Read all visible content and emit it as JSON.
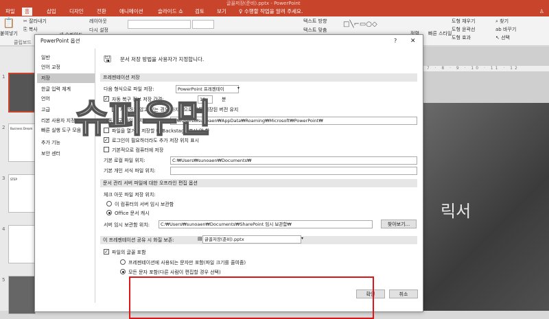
{
  "window": {
    "title": "글꼴저장(준비).pptx - PowerPoint"
  },
  "ribbon": {
    "tabs": [
      "파일",
      "홈",
      "삽입",
      "디자인",
      "전환",
      "애니메이션",
      "슬라이드 쇼",
      "검토",
      "보기"
    ],
    "active_tab": "홈",
    "tell_me": "수행할 작업을 알려 주세요.",
    "clipboard": {
      "paste": "붙여넣기",
      "cut": "잘라내기",
      "copy": "복사",
      "group_label": "클립보드"
    },
    "slides": {
      "new_slide": "새 슬라이드",
      "layout": "레이아웃",
      "reset": "다시 설정"
    },
    "paragraph": {
      "text_direction": "텍스트 방향",
      "align_text": "텍스트 맞춤"
    },
    "drawing": {
      "arrange": "정렬",
      "quick_styles": "빠른 스타일",
      "shape_fill": "도형 채우기",
      "shape_outline": "도형 윤곽선",
      "shape_effects": "도형 효과"
    },
    "editing": {
      "find": "찾기",
      "replace": "바꾸기",
      "select": "선택",
      "group_label": "편집"
    },
    "accent_color": "#c8442b"
  },
  "slide_pane": {
    "numbers": [
      "1",
      "2",
      "3",
      "4",
      "5"
    ],
    "thumb_text": [
      "Business Dream",
      "STEP"
    ]
  },
  "slide": {
    "big_text": "릭서",
    "ruler": "· 7 · 8 · 9 · 10 · 11 · 12"
  },
  "watermark": "슈퍼우먼",
  "dialog": {
    "title": "PowerPoint 옵션",
    "help": "?",
    "close": "✕",
    "nav": [
      "일반",
      "언어 교정",
      "저장",
      "한글 입력 체계",
      "언어",
      "고급",
      "리본 사용자 지정",
      "빠른 실행 도구 모음",
      "추가 기능",
      "보안 센터"
    ],
    "nav_active": "저장",
    "header": "문서 저장 방법을 사용자가 지정합니다.",
    "sec_save": "프레젠테이션 저장",
    "format_label": "다음 형식으로 파일 저장:",
    "format_value": "PowerPoint 프레젠테이",
    "autorecover_label": "자동 복구 정보 저장 간격:",
    "autorecover_minutes": "10",
    "minutes": "분",
    "keep_last_version": "저장하지 않고 닫는 경우 마지막으로 자동 저장된 버전 유지",
    "autorecover_loc_label": "자동 복구 파일 위치:",
    "autorecover_path": "C:₩Users₩sunoaen₩AppData₩Roaming₩Microsoft₩PowerPoint₩",
    "no_backstage": "파일을 열거나 저장할 때 Backstage 표시 안 함",
    "show_additional": "로그인이 필요하더라도 추가 저장 위치 표시",
    "save_default_pc": "기본적으로 컴퓨터에 저장",
    "default_local_label": "기본 로컬 파일 위치:",
    "default_local_path": "C:₩Users₩sunoaen₩Documents₩",
    "personal_templates_label": "기본 개인 서식 파일 위치:",
    "personal_templates_path": "",
    "sec_offline": "문서 관리 서버 파일에 대한 오프라인 편집 옵션",
    "checkout_label": "체크 아웃 파일 저장 위치:",
    "opt_server_drafts": "이 컴퓨터의 서버 임시 보관함",
    "opt_office_cache": "Office 문서 캐시",
    "server_drafts_label": "서버 임시 보관함 위치:",
    "server_drafts_path": "C:₩Users₩sunoaen₩Documents₩SharePoint 임시 보관함₩",
    "browse": "찾아보기...",
    "sec_fidelity": "이 프레젠테이션 공유 시 화질 보존:",
    "fidelity_file": "글꼴저장(준비).pptx",
    "embed_fonts": "파일의 글꼴 포함",
    "embed_subset": "프레젠테이션에 사용되는 문자만 포함(파일 크기를 줄여줌)",
    "embed_all": "모든 문자 포함(다른 사람이 편집할 경우 선택)",
    "ok": "확인",
    "cancel": "취소",
    "highlight_color": "#e01414"
  }
}
